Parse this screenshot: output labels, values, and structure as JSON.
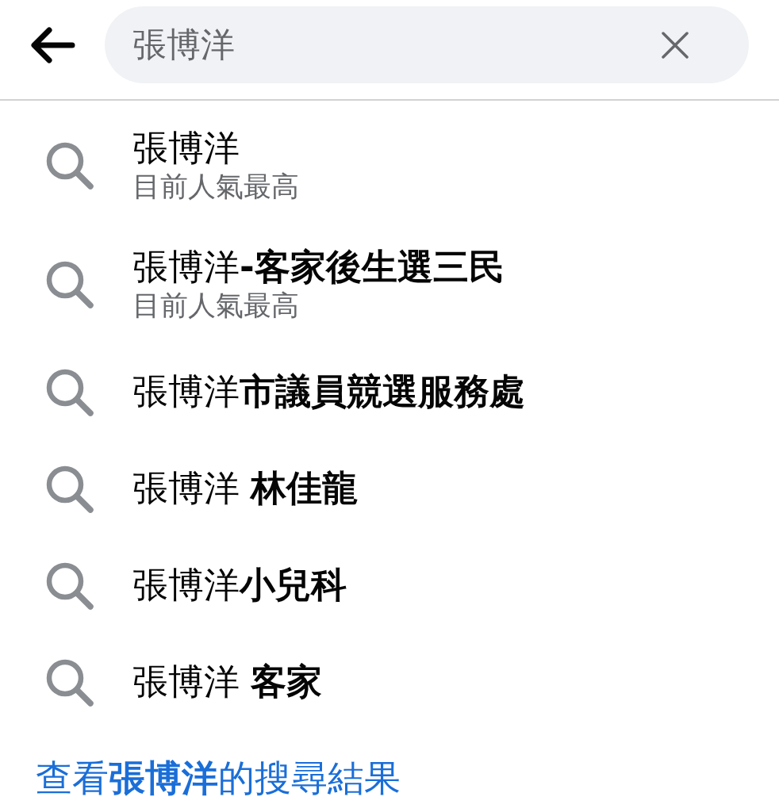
{
  "search_field": {
    "value": "張博洋"
  },
  "suggestions": [
    {
      "title": "張博洋",
      "subtitle": "目前人氣最高"
    },
    {
      "title": "張博洋**-客家後生選三民**",
      "subtitle": "目前人氣最高"
    },
    {
      "title": "張博洋**市議員競選服務處**"
    },
    {
      "title": "張博洋 **林佳龍**"
    },
    {
      "title": "張博洋**小兒科**"
    },
    {
      "title": "張博洋 **客家**"
    }
  ],
  "see_results_link": "查看**張博洋**的搜尋結果"
}
